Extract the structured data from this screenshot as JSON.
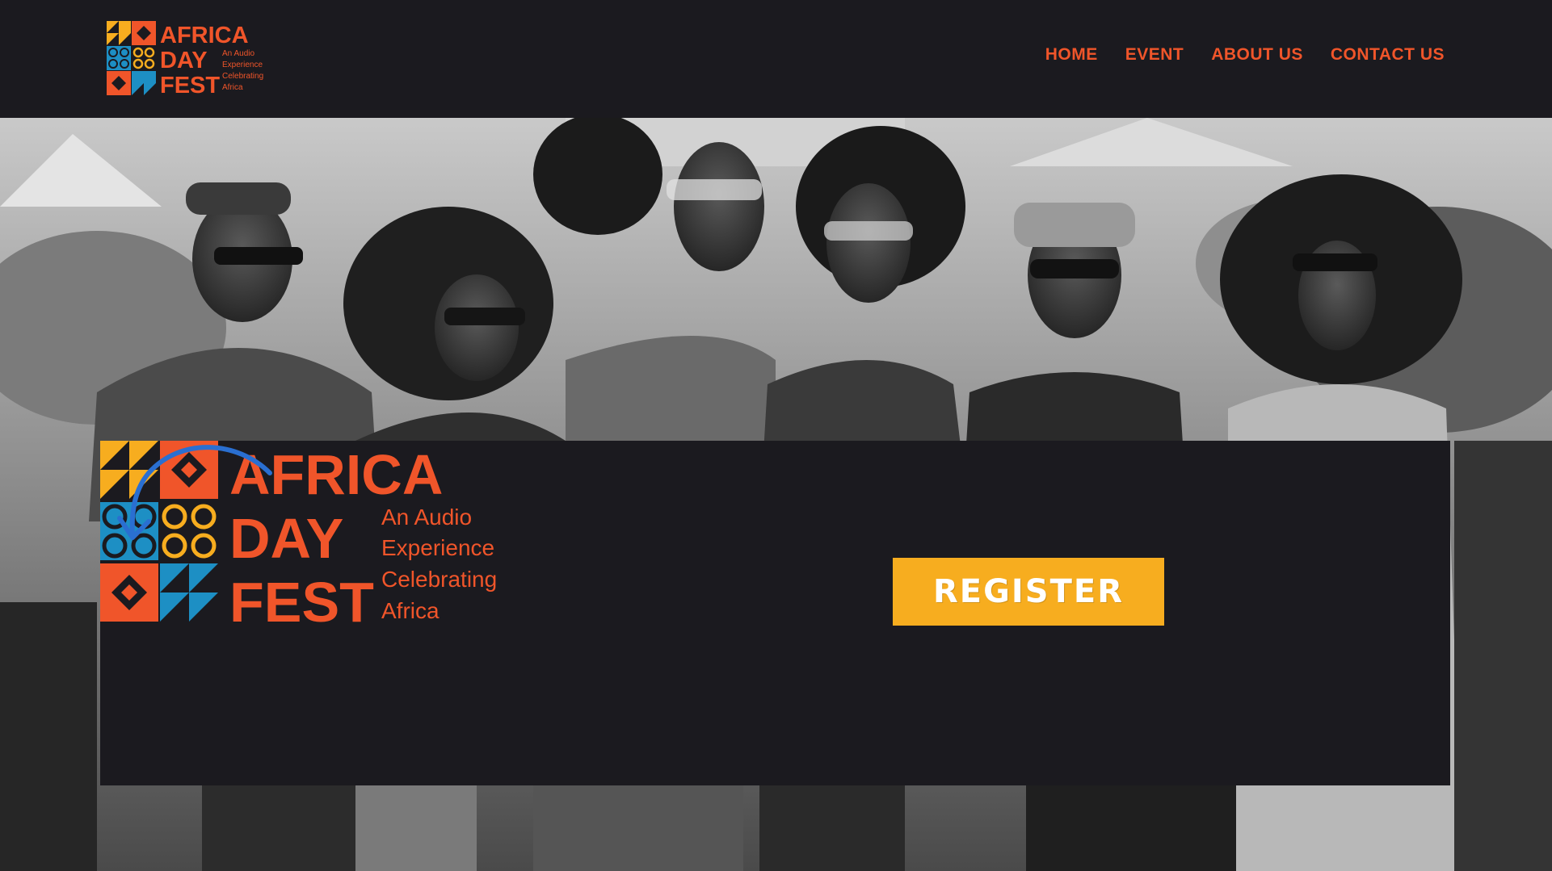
{
  "header": {
    "logo": {
      "line1": "AFRICA",
      "line2": "DAY",
      "line3": "FEST",
      "tagline": [
        "An Audio",
        "Experience",
        "Celebrating",
        "Africa"
      ]
    },
    "nav": [
      {
        "label": "HOME"
      },
      {
        "label": "EVENT"
      },
      {
        "label": "ABOUT US"
      },
      {
        "label": "CONTACT US"
      }
    ]
  },
  "hero": {
    "photo_description_icon": "crowd-photo",
    "logo": {
      "line1": "AFRICA",
      "line2": "DAY",
      "line3": "FEST",
      "tagline": [
        "An Audio",
        "Experience",
        "Celebrating",
        "Africa"
      ]
    },
    "register_label": "REGISTER"
  },
  "colors": {
    "background": "#1b1a1f",
    "brand_orange": "#f0552a",
    "brand_yellow": "#f7ad1f",
    "brand_blue": "#1d8fc4",
    "arrow_blue": "#2a6fd1"
  }
}
